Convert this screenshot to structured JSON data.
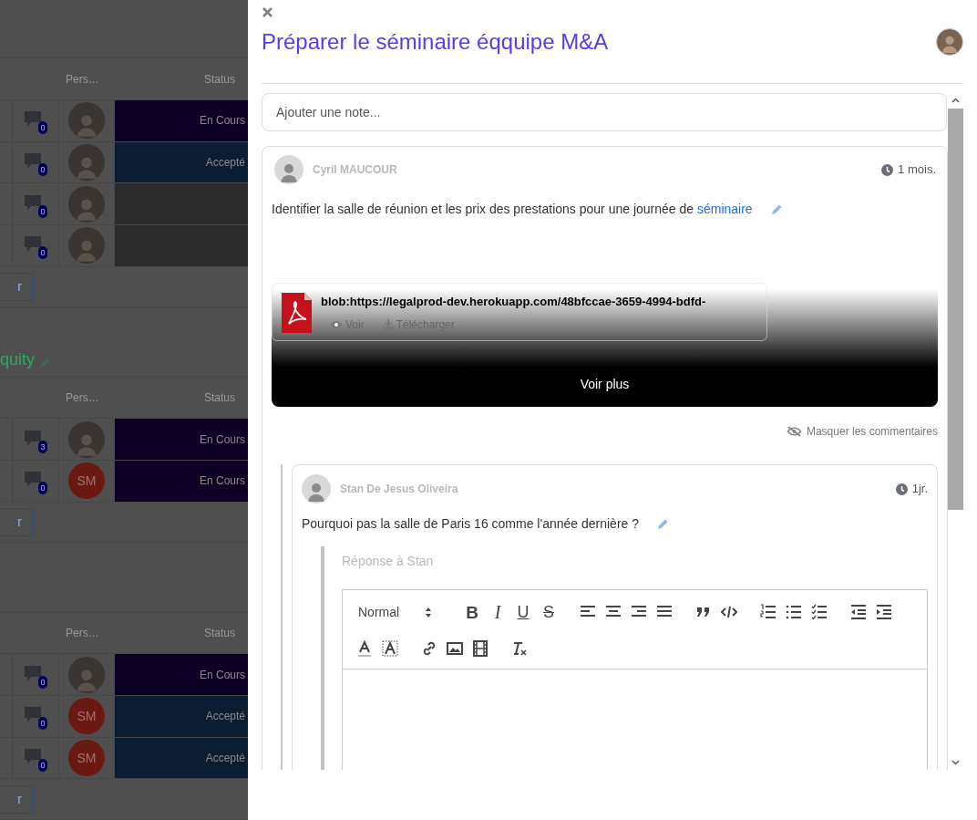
{
  "background": {
    "groups": [
      {
        "header": {
          "person": "Pers…",
          "status": "Status"
        },
        "rows": [
          {
            "comments": "0",
            "avatar": {
              "kind": "photo"
            },
            "status": "En Cours",
            "color": "#0c0024"
          },
          {
            "comments": "0",
            "avatar": {
              "kind": "photo"
            },
            "status": "Accepté",
            "color": "#0b1d33"
          },
          {
            "comments": "0",
            "avatar": {
              "kind": "photo"
            },
            "color": "#2b2b2b"
          },
          {
            "comments": "0",
            "avatar": {
              "kind": "photo"
            },
            "color": "#2b2b2b"
          }
        ],
        "button": "r"
      },
      {
        "title": "quity",
        "header": {
          "person": "Pers…",
          "status": "Status"
        },
        "rows": [
          {
            "comments": "3",
            "avatar": {
              "kind": "photo"
            },
            "status": "En Cours",
            "color": "#0c0024"
          },
          {
            "comments": "0",
            "avatar": {
              "kind": "initials",
              "text": "SM"
            },
            "status": "En Cours",
            "color": "#0c0024"
          }
        ],
        "button": "r"
      },
      {
        "header": {
          "person": "Pers…",
          "status": "Status"
        },
        "rows": [
          {
            "comments": "0",
            "avatar": {
              "kind": "photo"
            },
            "status": "En Cours",
            "color": "#0c0024"
          },
          {
            "comments": "0",
            "avatar": {
              "kind": "initials",
              "text": "SM"
            },
            "status": "Accepté",
            "color": "#0b1d33"
          },
          {
            "comments": "0",
            "avatar": {
              "kind": "initials",
              "text": "SM"
            },
            "status": "Accepté",
            "color": "#0b1d33"
          }
        ],
        "button": "r"
      }
    ]
  },
  "panel": {
    "title": "Préparer le séminaire éqquipe M&A",
    "note": {
      "placeholder": "Ajouter une note..."
    },
    "comment": {
      "author": "Cyril MAUCOUR",
      "time": "1 mois.",
      "text": "Identifier la salle de réunion et les prix des prestations pour une journée de",
      "link": "séminaire",
      "attachment": {
        "name": "blob:https://legalprod-dev.herokuapp.com/48bfccae-3659-4994-bdfd-",
        "view": "Voir",
        "download": "Télécharger"
      },
      "more": "Voir plus",
      "hide_comments": "Masquer les commentaires",
      "replies": [
        {
          "author": "Stan De Jesus Oliveira",
          "time": "1jr.",
          "text": "Pourquoi pas la salle de Paris 16 comme l'année dernière ?",
          "reply_box": {
            "placeholder": "Réponse à Stan",
            "format": "Normal",
            "marks": [
              "B",
              "I",
              "U",
              "S"
            ]
          }
        }
      ]
    }
  }
}
